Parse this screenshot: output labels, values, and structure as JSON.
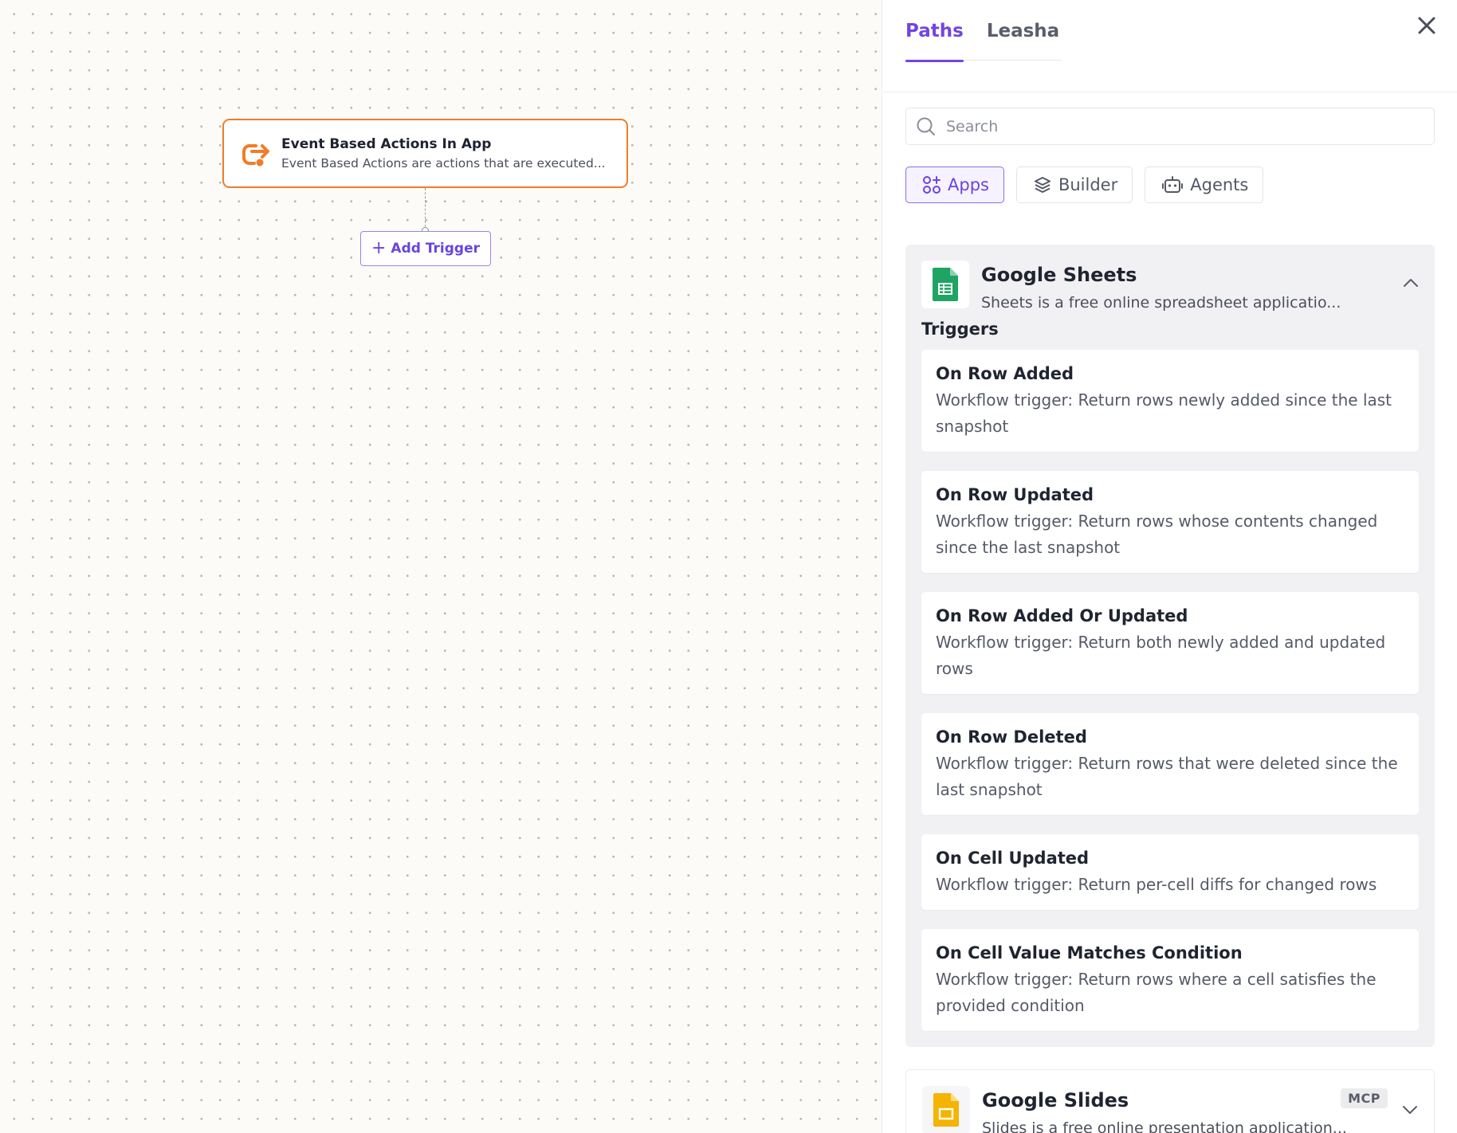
{
  "canvas": {
    "node": {
      "title": "Event Based Actions In App",
      "description": "Event Based Actions are actions that are executed..."
    },
    "add_trigger_label": "Add Trigger"
  },
  "panel": {
    "tabs": [
      {
        "label": "Paths",
        "active": true
      },
      {
        "label": "Leasha",
        "active": false
      }
    ],
    "search": {
      "placeholder": "Search",
      "value": ""
    },
    "filters": [
      {
        "label": "Apps",
        "icon": "apps-icon",
        "active": true
      },
      {
        "label": "Builder",
        "icon": "builder-icon",
        "active": false
      },
      {
        "label": "Agents",
        "icon": "robot-icon",
        "active": false
      }
    ],
    "apps": [
      {
        "name": "Google Sheets",
        "description": "Sheets is a free online spreadsheet applicatio...",
        "expanded": true,
        "section_label": "Triggers",
        "triggers": [
          {
            "title": "On Row Added",
            "description": "Workflow trigger: Return rows newly added since the last snapshot"
          },
          {
            "title": "On Row Updated",
            "description": "Workflow trigger: Return rows whose contents changed since the last snapshot"
          },
          {
            "title": "On Row Added Or Updated",
            "description": "Workflow trigger: Return both newly added and updated rows"
          },
          {
            "title": "On Row Deleted",
            "description": "Workflow trigger: Return rows that were deleted since the last snapshot"
          },
          {
            "title": "On Cell Updated",
            "description": "Workflow trigger: Return per-cell diffs for changed rows"
          },
          {
            "title": "On Cell Value Matches Condition",
            "description": "Workflow trigger: Return rows where a cell satisfies the provided condition"
          }
        ]
      },
      {
        "name": "Google Slides",
        "description": "Slides is a free online presentation application...",
        "badge": "MCP",
        "expanded": false
      }
    ]
  },
  "colors": {
    "accent": "#7046e0",
    "node_border": "#ef7d28",
    "sheets_green": "#1fa463",
    "slides_yellow": "#f4b400"
  }
}
